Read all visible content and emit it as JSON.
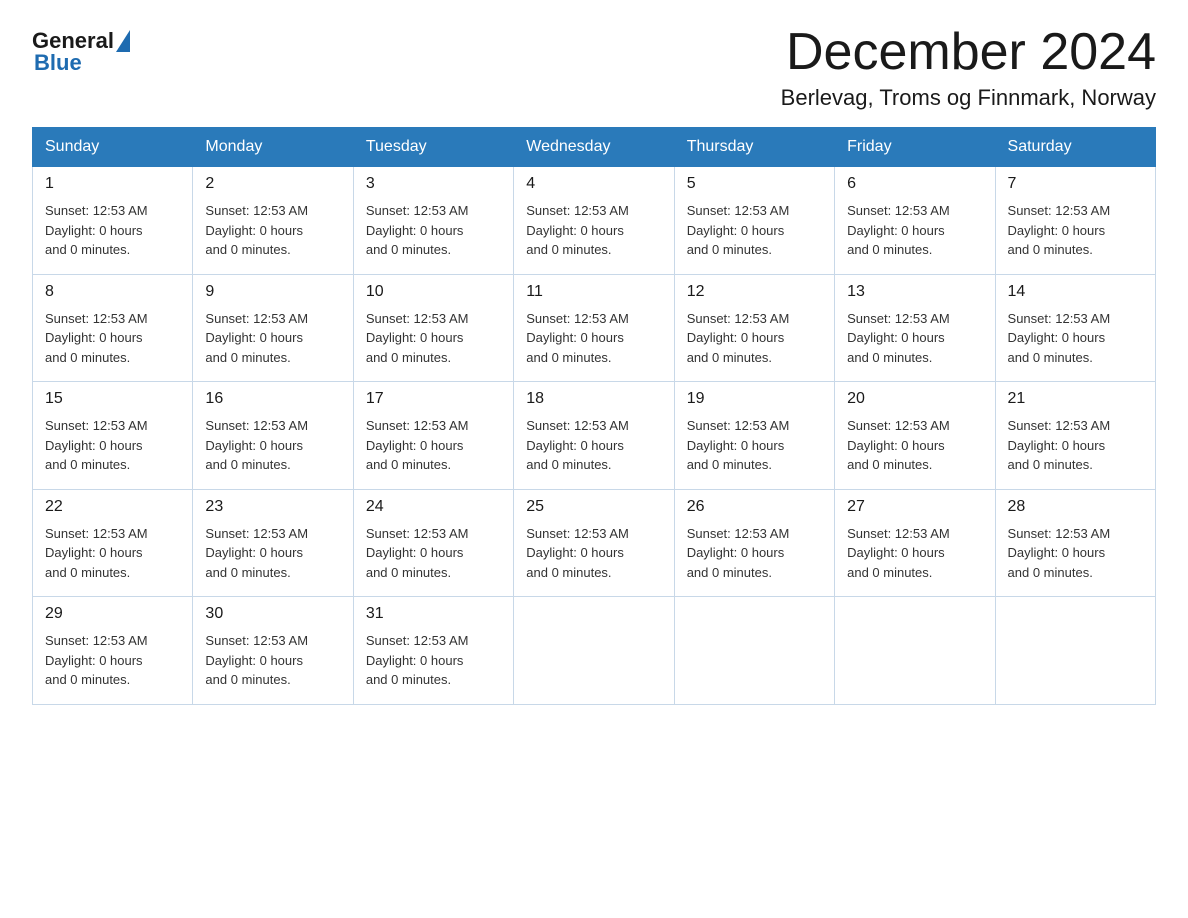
{
  "logo": {
    "text_general": "General",
    "text_blue": "Blue"
  },
  "header": {
    "month_year": "December 2024",
    "location": "Berlevag, Troms og Finnmark, Norway"
  },
  "weekdays": [
    "Sunday",
    "Monday",
    "Tuesday",
    "Wednesday",
    "Thursday",
    "Friday",
    "Saturday"
  ],
  "weeks": [
    [
      {
        "day": "1",
        "info": "Sunset: 12:53 AM\nDaylight: 0 hours\nand 0 minutes."
      },
      {
        "day": "2",
        "info": "Sunset: 12:53 AM\nDaylight: 0 hours\nand 0 minutes."
      },
      {
        "day": "3",
        "info": "Sunset: 12:53 AM\nDaylight: 0 hours\nand 0 minutes."
      },
      {
        "day": "4",
        "info": "Sunset: 12:53 AM\nDaylight: 0 hours\nand 0 minutes."
      },
      {
        "day": "5",
        "info": "Sunset: 12:53 AM\nDaylight: 0 hours\nand 0 minutes."
      },
      {
        "day": "6",
        "info": "Sunset: 12:53 AM\nDaylight: 0 hours\nand 0 minutes."
      },
      {
        "day": "7",
        "info": "Sunset: 12:53 AM\nDaylight: 0 hours\nand 0 minutes."
      }
    ],
    [
      {
        "day": "8",
        "info": "Sunset: 12:53 AM\nDaylight: 0 hours\nand 0 minutes."
      },
      {
        "day": "9",
        "info": "Sunset: 12:53 AM\nDaylight: 0 hours\nand 0 minutes."
      },
      {
        "day": "10",
        "info": "Sunset: 12:53 AM\nDaylight: 0 hours\nand 0 minutes."
      },
      {
        "day": "11",
        "info": "Sunset: 12:53 AM\nDaylight: 0 hours\nand 0 minutes."
      },
      {
        "day": "12",
        "info": "Sunset: 12:53 AM\nDaylight: 0 hours\nand 0 minutes."
      },
      {
        "day": "13",
        "info": "Sunset: 12:53 AM\nDaylight: 0 hours\nand 0 minutes."
      },
      {
        "day": "14",
        "info": "Sunset: 12:53 AM\nDaylight: 0 hours\nand 0 minutes."
      }
    ],
    [
      {
        "day": "15",
        "info": "Sunset: 12:53 AM\nDaylight: 0 hours\nand 0 minutes."
      },
      {
        "day": "16",
        "info": "Sunset: 12:53 AM\nDaylight: 0 hours\nand 0 minutes."
      },
      {
        "day": "17",
        "info": "Sunset: 12:53 AM\nDaylight: 0 hours\nand 0 minutes."
      },
      {
        "day": "18",
        "info": "Sunset: 12:53 AM\nDaylight: 0 hours\nand 0 minutes."
      },
      {
        "day": "19",
        "info": "Sunset: 12:53 AM\nDaylight: 0 hours\nand 0 minutes."
      },
      {
        "day": "20",
        "info": "Sunset: 12:53 AM\nDaylight: 0 hours\nand 0 minutes."
      },
      {
        "day": "21",
        "info": "Sunset: 12:53 AM\nDaylight: 0 hours\nand 0 minutes."
      }
    ],
    [
      {
        "day": "22",
        "info": "Sunset: 12:53 AM\nDaylight: 0 hours\nand 0 minutes."
      },
      {
        "day": "23",
        "info": "Sunset: 12:53 AM\nDaylight: 0 hours\nand 0 minutes."
      },
      {
        "day": "24",
        "info": "Sunset: 12:53 AM\nDaylight: 0 hours\nand 0 minutes."
      },
      {
        "day": "25",
        "info": "Sunset: 12:53 AM\nDaylight: 0 hours\nand 0 minutes."
      },
      {
        "day": "26",
        "info": "Sunset: 12:53 AM\nDaylight: 0 hours\nand 0 minutes."
      },
      {
        "day": "27",
        "info": "Sunset: 12:53 AM\nDaylight: 0 hours\nand 0 minutes."
      },
      {
        "day": "28",
        "info": "Sunset: 12:53 AM\nDaylight: 0 hours\nand 0 minutes."
      }
    ],
    [
      {
        "day": "29",
        "info": "Sunset: 12:53 AM\nDaylight: 0 hours\nand 0 minutes."
      },
      {
        "day": "30",
        "info": "Sunset: 12:53 AM\nDaylight: 0 hours\nand 0 minutes."
      },
      {
        "day": "31",
        "info": "Sunset: 12:53 AM\nDaylight: 0 hours\nand 0 minutes."
      },
      {
        "day": "",
        "info": ""
      },
      {
        "day": "",
        "info": ""
      },
      {
        "day": "",
        "info": ""
      },
      {
        "day": "",
        "info": ""
      }
    ]
  ]
}
